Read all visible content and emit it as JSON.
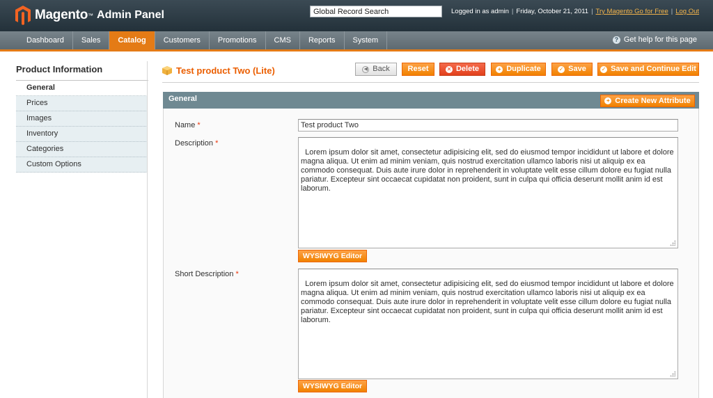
{
  "header": {
    "brand": "Magento",
    "brand_sub": "Admin Panel",
    "search_value": "Global Record Search",
    "logged_in": "Logged in as admin",
    "date": "Friday, October 21, 2011",
    "try_link": "Try Magento Go for Free",
    "logout_link": "Log Out"
  },
  "nav": {
    "items": [
      "Dashboard",
      "Sales",
      "Catalog",
      "Customers",
      "Promotions",
      "CMS",
      "Reports",
      "System"
    ],
    "active": "Catalog",
    "help": "Get help for this page"
  },
  "sidebar": {
    "title": "Product Information",
    "items": [
      "General",
      "Prices",
      "Images",
      "Inventory",
      "Categories",
      "Custom Options"
    ],
    "active": "General"
  },
  "page": {
    "title": "Test product Two (Lite)",
    "buttons": {
      "back": "Back",
      "reset": "Reset",
      "delete": "Delete",
      "duplicate": "Duplicate",
      "save": "Save",
      "save_continue": "Save and Continue Edit"
    }
  },
  "fieldset": {
    "title": "General",
    "create_attribute": "Create New Attribute",
    "name_label": "Name",
    "name_value": "Test product Two",
    "description_label": "Description",
    "description_value": "Lorem ipsum dolor sit amet, consectetur adipisicing elit, sed do eiusmod tempor incididunt ut labore et dolore magna aliqua. Ut enim ad minim veniam, quis nostrud exercitation ullamco laboris nisi ut aliquip ex ea commodo consequat. Duis aute irure dolor in reprehenderit in voluptate velit esse cillum dolore eu fugiat nulla pariatur. Excepteur sint occaecat cupidatat non proident, sunt in culpa qui officia deserunt mollit anim id est laborum.",
    "short_description_label": "Short Description",
    "short_description_value": "Lorem ipsum dolor sit amet, consectetur adipisicing elit, sed do eiusmod tempor incididunt ut labore et dolore magna aliqua. Ut enim ad minim veniam, quis nostrud exercitation ullamco laboris nisi ut aliquip ex ea commodo consequat. Duis aute irure dolor in reprehenderit in voluptate velit esse cillum dolore eu fugiat nulla pariatur. Excepteur sint occaecat cupidatat non proident, sunt in culpa qui officia deserunt mollit anim id est laborum.",
    "required_mark": "*",
    "wysiwyg_label": "WYSIWYG Editor"
  },
  "colors": {
    "accent": "#e47b16",
    "header_bg": "#2c3a43",
    "nav_bg": "#6a767d",
    "title_orange": "#eb5e00",
    "fieldset_head": "#6f8992",
    "delete_red": "#e2401c"
  },
  "icons": {
    "logo": "magento-logo-icon",
    "help": "help-icon",
    "product": "box-icon",
    "back": "back-arrow-icon",
    "delete": "delete-icon",
    "add": "plus-circle-icon",
    "save": "check-circle-icon"
  }
}
